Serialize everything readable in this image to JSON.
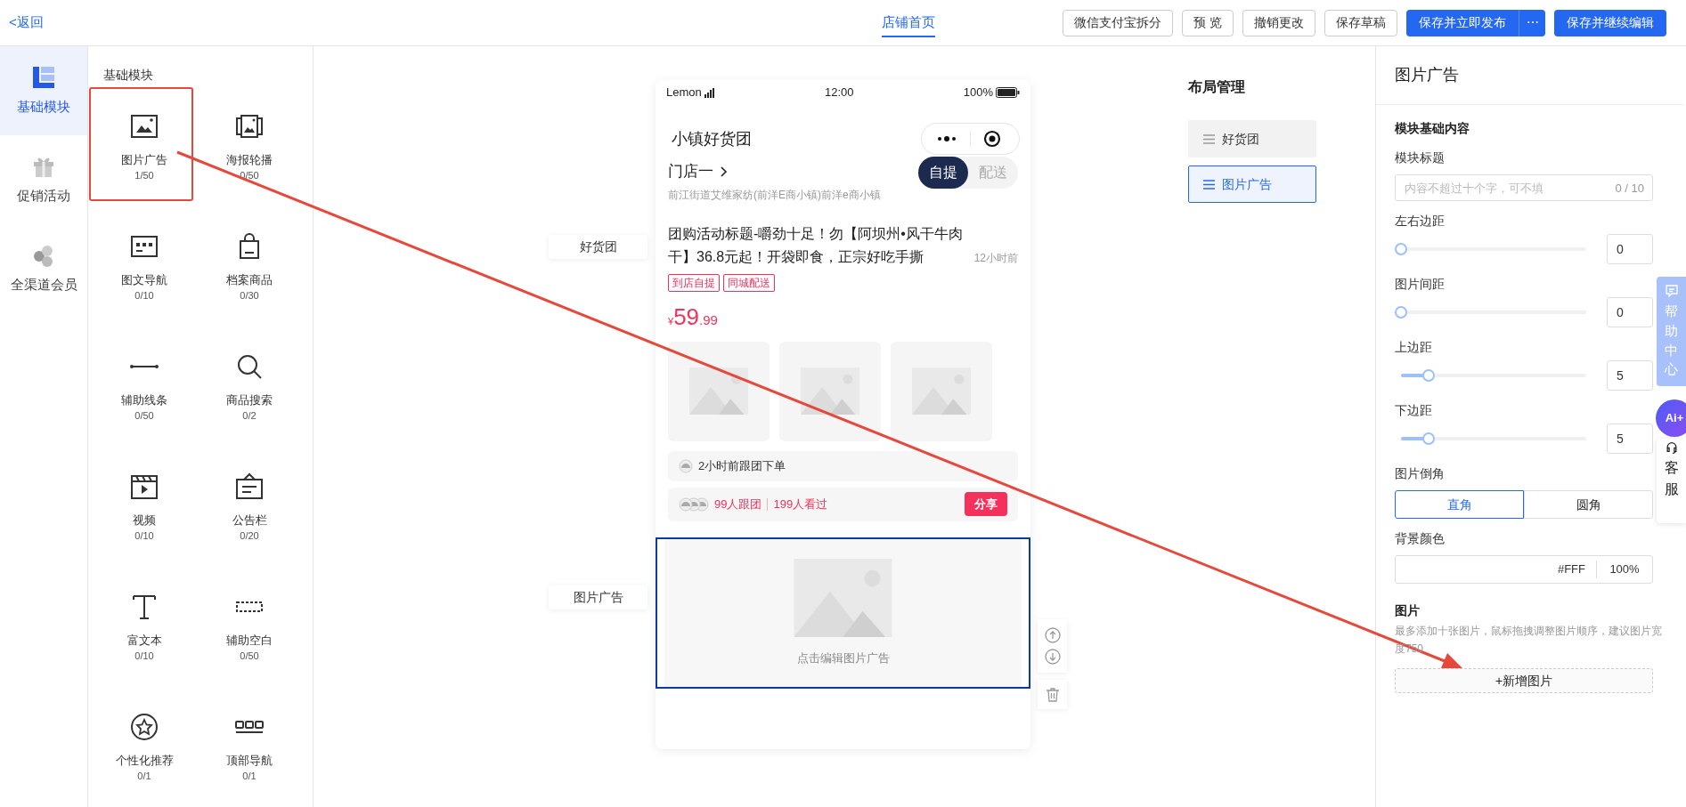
{
  "header": {
    "back": "<返回",
    "title": "店铺首页",
    "buttons": [
      {
        "label": "微信支付宝拆分",
        "kind": "default"
      },
      {
        "label": "预 览",
        "kind": "default"
      },
      {
        "label": "撤销更改",
        "kind": "default"
      },
      {
        "label": "保存草稿",
        "kind": "default"
      },
      {
        "label": "保存并立即发布",
        "kind": "split",
        "more": "⋯"
      },
      {
        "label": "保存并继续编辑",
        "kind": "primary"
      }
    ]
  },
  "sidebar": {
    "items": [
      {
        "label": "基础模块",
        "kind": "blocks",
        "selected": true
      },
      {
        "label": "促销活动",
        "kind": "gift",
        "selected": false
      },
      {
        "label": "全渠道会员",
        "kind": "hex",
        "selected": false
      }
    ]
  },
  "modules": {
    "title": "基础模块",
    "items": [
      {
        "label": "图片广告",
        "count": "1/50",
        "kind": "image"
      },
      {
        "label": "海报轮播",
        "count": "0/50",
        "kind": "poster"
      },
      {
        "label": "图文导航",
        "count": "0/10",
        "kind": "nav"
      },
      {
        "label": "档案商品",
        "count": "0/30",
        "kind": "bag"
      },
      {
        "label": "辅助线条",
        "count": "0/50",
        "kind": "line"
      },
      {
        "label": "商品搜索",
        "count": "0/2",
        "kind": "search"
      },
      {
        "label": "视频",
        "count": "0/10",
        "kind": "video"
      },
      {
        "label": "公告栏",
        "count": "0/20",
        "kind": "notice"
      },
      {
        "label": "富文本",
        "count": "0/10",
        "kind": "text"
      },
      {
        "label": "辅助空白",
        "count": "0/50",
        "kind": "blank"
      },
      {
        "label": "个性化推荐",
        "count": "0/1",
        "kind": "star"
      },
      {
        "label": "顶部导航",
        "count": "0/1",
        "kind": "tabs"
      }
    ]
  },
  "canvas": {
    "tags": [
      "好货团",
      "图片广告"
    ],
    "phone": {
      "carrier": "Lemon",
      "time": "12:00",
      "battery": "100%",
      "title": "小镇好货团",
      "store": "门店一",
      "address": "前江街道艾维家纺(前洋E商小镇)前洋e商小镇",
      "delivery": [
        {
          "label": "自提",
          "selected": true
        },
        {
          "label": "配送",
          "selected": false
        }
      ],
      "product": {
        "title": "团购活动标题-嚼劲十足！勿【阿坝州•风干牛肉干】36.8元起！开袋即食，正宗好吃手撕",
        "time": "12小时前",
        "tags": [
          "到店自提",
          "同城配送"
        ],
        "currency": "¥",
        "price": "59",
        "decimals": ".99",
        "recent": "2小时前跟团下单",
        "joined": "99人跟团",
        "viewed": "199人看过",
        "share": "分享"
      },
      "ad": {
        "hint": "点击编辑图片广告",
        "selected": true
      }
    }
  },
  "layout": {
    "title": "布局管理",
    "items": [
      {
        "label": "好货团",
        "selected": false
      },
      {
        "label": "图片广告",
        "selected": true
      }
    ]
  },
  "panel": {
    "title": "图片广告",
    "section": "模块基础内容",
    "title_field": {
      "label": "模块标题",
      "placeholder": "内容不超过十个字，可不填",
      "counter": "0 / 10"
    },
    "sliders": [
      {
        "label": "左右边距",
        "level": 0,
        "value": "0"
      },
      {
        "label": "图片间距",
        "level": 0,
        "value": "0"
      },
      {
        "label": "上边距",
        "level": 0.15,
        "value": "5"
      },
      {
        "label": "下边距",
        "level": 0.15,
        "value": "5"
      }
    ],
    "corner": {
      "label": "图片倒角",
      "options": [
        {
          "label": "直角",
          "selected": true
        },
        {
          "label": "圆角",
          "selected": false
        }
      ]
    },
    "background": {
      "label": "背景颜色",
      "value": "#FFF",
      "opacity": "100%"
    },
    "images": {
      "title": "图片",
      "hint": "最多添加十张图片，鼠标拖拽调整图片顺序，建议图片宽度750",
      "add": "+新增图片"
    }
  },
  "float": {
    "help": "帮助中心",
    "ai": "Ai+",
    "service": "客服"
  }
}
